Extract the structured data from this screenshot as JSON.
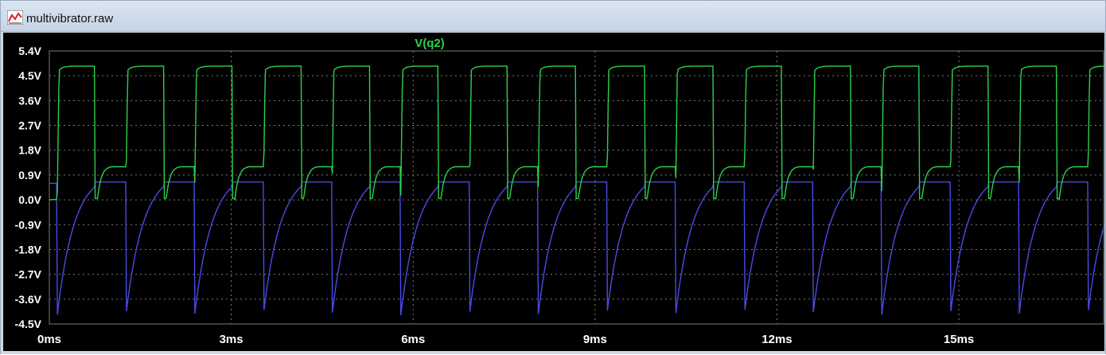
{
  "window": {
    "title": "multivibrator.raw",
    "icon": "waveform-icon"
  },
  "colors": {
    "background": "#000000",
    "grid": "#7a7a7a",
    "axis_text": "#ffffff",
    "trace_green": "#2bd24a",
    "trace_blue": "#4a4ae6",
    "trace_label": "#2bd24a"
  },
  "chart_data": {
    "type": "line",
    "title": "",
    "trace_label": "V(q2)",
    "xlabel": "",
    "ylabel": "",
    "xlim": [
      0,
      17.4
    ],
    "ylim": [
      -4.5,
      5.4
    ],
    "x_ticks": [
      "0ms",
      "3ms",
      "6ms",
      "9ms",
      "12ms",
      "15ms"
    ],
    "x_tick_values": [
      0,
      3,
      6,
      9,
      12,
      15
    ],
    "y_ticks": [
      "5.4V",
      "4.5V",
      "3.6V",
      "2.7V",
      "1.8V",
      "0.9V",
      "0.0V",
      "-0.9V",
      "-1.8V",
      "-2.7V",
      "-3.6V",
      "-4.5V"
    ],
    "y_tick_values": [
      5.4,
      4.5,
      3.6,
      2.7,
      1.8,
      0.9,
      0.0,
      -0.9,
      -1.8,
      -2.7,
      -3.6,
      -4.5
    ],
    "grid": true,
    "period_ms": 1.133,
    "start_ms": 0.13,
    "series": [
      {
        "name": "V(q2)",
        "shape": "square-with-step",
        "high_v": 4.85,
        "mid_v": 1.2,
        "low_v": 0.0,
        "high_fraction": 0.55,
        "mid_fraction": 0.45
      },
      {
        "name": "",
        "shape": "sawtooth-exp",
        "high_v": 0.65,
        "low_v": -4.2,
        "flat_fraction": 0.55
      }
    ]
  }
}
